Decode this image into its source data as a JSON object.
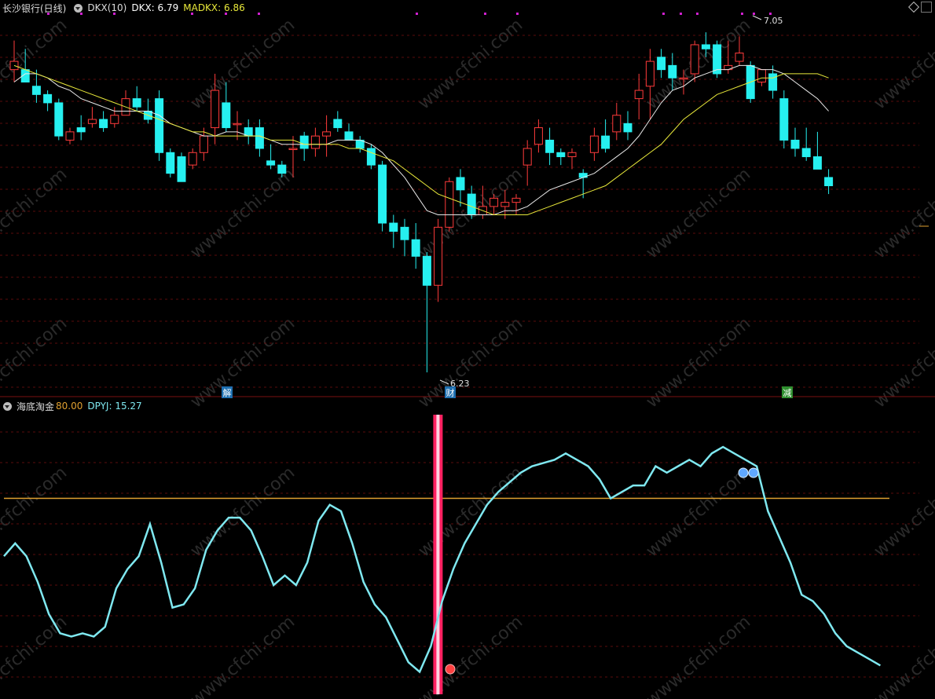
{
  "top_panel": {
    "stock_name": "长沙银行(日线)",
    "indicator_name": "DKX(10)",
    "dkx_label": "DKX: 6.79",
    "madkx_label": "MADKX: 6.86",
    "high_label": "7.05",
    "low_label": "6.23",
    "markers": [
      {
        "text": "解",
        "color": "#1e6fb0"
      },
      {
        "text": "财",
        "color": "#1e6fb0"
      },
      {
        "text": "减",
        "color": "#2f8f2f"
      }
    ]
  },
  "bottom_panel": {
    "indicator_name": "海底淘金",
    "level_label": "80.00",
    "dpyj_label": "DPYJ: 15.27"
  },
  "colors": {
    "up": "#ff3b3b",
    "down": "#26f0f0",
    "dkx_line": "#e8e8e8",
    "madkx_line": "#e8e83a",
    "osc_line": "#7fe8f0",
    "level_line": "#e0a030",
    "signal_bar": "#ff2060",
    "grid": "#5a0c0c"
  },
  "chart_data": {
    "type": "candlestick",
    "candles": [
      {
        "o": 6.96,
        "h": 7.03,
        "l": 6.93,
        "c": 6.98
      },
      {
        "o": 6.96,
        "h": 7.01,
        "l": 6.94,
        "c": 6.93
      },
      {
        "o": 6.92,
        "h": 6.96,
        "l": 6.88,
        "c": 6.9
      },
      {
        "o": 6.9,
        "h": 6.91,
        "l": 6.86,
        "c": 6.88
      },
      {
        "o": 6.88,
        "h": 6.89,
        "l": 6.79,
        "c": 6.8
      },
      {
        "o": 6.79,
        "h": 6.82,
        "l": 6.78,
        "c": 6.81
      },
      {
        "o": 6.82,
        "h": 6.85,
        "l": 6.79,
        "c": 6.81
      },
      {
        "o": 6.83,
        "h": 6.87,
        "l": 6.82,
        "c": 6.84
      },
      {
        "o": 6.84,
        "h": 6.86,
        "l": 6.81,
        "c": 6.82
      },
      {
        "o": 6.83,
        "h": 6.87,
        "l": 6.82,
        "c": 6.85
      },
      {
        "o": 6.85,
        "h": 6.91,
        "l": 6.86,
        "c": 6.89
      },
      {
        "o": 6.89,
        "h": 6.92,
        "l": 6.86,
        "c": 6.87
      },
      {
        "o": 6.86,
        "h": 6.89,
        "l": 6.83,
        "c": 6.84
      },
      {
        "o": 6.89,
        "h": 6.91,
        "l": 6.74,
        "c": 6.76
      },
      {
        "o": 6.76,
        "h": 6.77,
        "l": 6.7,
        "c": 6.71
      },
      {
        "o": 6.75,
        "h": 6.76,
        "l": 6.69,
        "c": 6.69
      },
      {
        "o": 6.73,
        "h": 6.77,
        "l": 6.72,
        "c": 6.76
      },
      {
        "o": 6.76,
        "h": 6.82,
        "l": 6.74,
        "c": 6.8
      },
      {
        "o": 6.82,
        "h": 6.95,
        "l": 6.78,
        "c": 6.91
      },
      {
        "o": 6.88,
        "h": 6.93,
        "l": 6.81,
        "c": 6.82
      },
      {
        "o": 6.83,
        "h": 6.86,
        "l": 6.79,
        "c": 6.83
      },
      {
        "o": 6.82,
        "h": 6.84,
        "l": 6.78,
        "c": 6.8
      },
      {
        "o": 6.82,
        "h": 6.84,
        "l": 6.75,
        "c": 6.77
      },
      {
        "o": 6.74,
        "h": 6.78,
        "l": 6.72,
        "c": 6.73
      },
      {
        "o": 6.73,
        "h": 6.74,
        "l": 6.7,
        "c": 6.71
      },
      {
        "o": 6.77,
        "h": 6.8,
        "l": 6.7,
        "c": 6.77
      },
      {
        "o": 6.8,
        "h": 6.81,
        "l": 6.74,
        "c": 6.77
      },
      {
        "o": 6.77,
        "h": 6.82,
        "l": 6.75,
        "c": 6.8
      },
      {
        "o": 6.8,
        "h": 6.85,
        "l": 6.75,
        "c": 6.81
      },
      {
        "o": 6.84,
        "h": 6.86,
        "l": 6.81,
        "c": 6.82
      },
      {
        "o": 6.81,
        "h": 6.83,
        "l": 6.79,
        "c": 6.79
      },
      {
        "o": 6.79,
        "h": 6.8,
        "l": 6.76,
        "c": 6.77
      },
      {
        "o": 6.77,
        "h": 6.78,
        "l": 6.72,
        "c": 6.73
      },
      {
        "o": 6.73,
        "h": 6.74,
        "l": 6.57,
        "c": 6.59
      },
      {
        "o": 6.59,
        "h": 6.61,
        "l": 6.53,
        "c": 6.57
      },
      {
        "o": 6.58,
        "h": 6.6,
        "l": 6.51,
        "c": 6.55
      },
      {
        "o": 6.55,
        "h": 6.59,
        "l": 6.48,
        "c": 6.51
      },
      {
        "o": 6.51,
        "h": 6.52,
        "l": 6.23,
        "c": 6.44
      },
      {
        "o": 6.44,
        "h": 6.6,
        "l": 6.4,
        "c": 6.58
      },
      {
        "o": 6.58,
        "h": 6.7,
        "l": 6.57,
        "c": 6.69
      },
      {
        "o": 6.7,
        "h": 6.72,
        "l": 6.63,
        "c": 6.67
      },
      {
        "o": 6.66,
        "h": 6.68,
        "l": 6.6,
        "c": 6.61
      },
      {
        "o": 6.61,
        "h": 6.68,
        "l": 6.6,
        "c": 6.63
      },
      {
        "o": 6.63,
        "h": 6.66,
        "l": 6.61,
        "c": 6.65
      },
      {
        "o": 6.63,
        "h": 6.67,
        "l": 6.6,
        "c": 6.64
      },
      {
        "o": 6.64,
        "h": 6.66,
        "l": 6.61,
        "c": 6.65
      },
      {
        "o": 6.73,
        "h": 6.79,
        "l": 6.68,
        "c": 6.77
      },
      {
        "o": 6.78,
        "h": 6.84,
        "l": 6.76,
        "c": 6.82
      },
      {
        "o": 6.79,
        "h": 6.82,
        "l": 6.73,
        "c": 6.76
      },
      {
        "o": 6.76,
        "h": 6.77,
        "l": 6.73,
        "c": 6.75
      },
      {
        "o": 6.75,
        "h": 6.77,
        "l": 6.72,
        "c": 6.76
      },
      {
        "o": 6.71,
        "h": 6.72,
        "l": 6.65,
        "c": 6.7
      },
      {
        "o": 6.76,
        "h": 6.82,
        "l": 6.74,
        "c": 6.8
      },
      {
        "o": 6.8,
        "h": 6.84,
        "l": 6.76,
        "c": 6.77
      },
      {
        "o": 6.81,
        "h": 6.88,
        "l": 6.79,
        "c": 6.85
      },
      {
        "o": 6.83,
        "h": 6.86,
        "l": 6.79,
        "c": 6.81
      },
      {
        "o": 6.89,
        "h": 6.95,
        "l": 6.84,
        "c": 6.91
      },
      {
        "o": 6.92,
        "h": 7.01,
        "l": 6.84,
        "c": 6.98
      },
      {
        "o": 6.99,
        "h": 7.01,
        "l": 6.94,
        "c": 6.96
      },
      {
        "o": 6.97,
        "h": 7.0,
        "l": 6.91,
        "c": 6.94
      },
      {
        "o": 6.94,
        "h": 6.96,
        "l": 6.9,
        "c": 6.94
      },
      {
        "o": 6.95,
        "h": 7.03,
        "l": 6.93,
        "c": 7.02
      },
      {
        "o": 7.02,
        "h": 7.05,
        "l": 6.99,
        "c": 7.01
      },
      {
        "o": 7.02,
        "h": 7.03,
        "l": 6.94,
        "c": 6.95
      },
      {
        "o": 6.96,
        "h": 7.03,
        "l": 6.95,
        "c": 6.97
      },
      {
        "o": 6.98,
        "h": 7.04,
        "l": 6.97,
        "c": 7.0
      },
      {
        "o": 6.97,
        "h": 6.98,
        "l": 6.88,
        "c": 6.89
      },
      {
        "o": 6.93,
        "h": 6.96,
        "l": 6.92,
        "c": 6.96
      },
      {
        "o": 6.95,
        "h": 6.97,
        "l": 6.89,
        "c": 6.91
      },
      {
        "o": 6.89,
        "h": 6.91,
        "l": 6.77,
        "c": 6.79
      },
      {
        "o": 6.79,
        "h": 6.82,
        "l": 6.75,
        "c": 6.77
      },
      {
        "o": 6.77,
        "h": 6.82,
        "l": 6.74,
        "c": 6.75
      },
      {
        "o": 6.75,
        "h": 6.81,
        "l": 6.72,
        "c": 6.72
      },
      {
        "o": 6.7,
        "h": 6.72,
        "l": 6.66,
        "c": 6.68
      }
    ],
    "dkx": [
      6.93,
      6.95,
      6.95,
      6.94,
      6.92,
      6.91,
      6.89,
      6.88,
      6.87,
      6.86,
      6.86,
      6.86,
      6.86,
      6.85,
      6.83,
      6.82,
      6.81,
      6.8,
      6.8,
      6.81,
      6.81,
      6.8,
      6.8,
      6.79,
      6.78,
      6.78,
      6.78,
      6.78,
      6.78,
      6.79,
      6.79,
      6.79,
      6.78,
      6.76,
      6.73,
      6.7,
      6.66,
      6.62,
      6.61,
      6.61,
      6.61,
      6.61,
      6.61,
      6.61,
      6.62,
      6.62,
      6.63,
      6.65,
      6.67,
      6.68,
      6.69,
      6.7,
      6.71,
      6.73,
      6.75,
      6.77,
      6.8,
      6.84,
      6.88,
      6.91,
      6.92,
      6.94,
      6.95,
      6.96,
      6.96,
      6.97,
      6.97,
      6.96,
      6.96,
      6.95,
      6.93,
      6.91,
      6.89,
      6.86
    ],
    "madkx": [
      6.97,
      6.96,
      6.95,
      6.94,
      6.93,
      6.92,
      6.91,
      6.9,
      6.89,
      6.88,
      6.87,
      6.86,
      6.85,
      6.84,
      6.83,
      6.82,
      6.81,
      6.81,
      6.8,
      6.8,
      6.8,
      6.8,
      6.8,
      6.79,
      6.79,
      6.79,
      6.78,
      6.78,
      6.78,
      6.78,
      6.77,
      6.77,
      6.76,
      6.75,
      6.74,
      6.72,
      6.7,
      6.68,
      6.66,
      6.65,
      6.64,
      6.63,
      6.62,
      6.61,
      6.61,
      6.61,
      6.61,
      6.62,
      6.63,
      6.64,
      6.65,
      6.66,
      6.67,
      6.68,
      6.7,
      6.72,
      6.74,
      6.76,
      6.78,
      6.81,
      6.84,
      6.86,
      6.88,
      6.9,
      6.91,
      6.92,
      6.93,
      6.94,
      6.94,
      6.95,
      6.95,
      6.95,
      6.95,
      6.94
    ],
    "oscillator": [
      62,
      66,
      62,
      54,
      44,
      38,
      37,
      38,
      37,
      40,
      52,
      58,
      62,
      72,
      60,
      46,
      47,
      52,
      64,
      70,
      74,
      74,
      70,
      62,
      53,
      56,
      53,
      60,
      73,
      78,
      76,
      66,
      54,
      47,
      43,
      36,
      29,
      26,
      34,
      48,
      58,
      66,
      72,
      78,
      82,
      85,
      88,
      90,
      91,
      92,
      94,
      92,
      90,
      86,
      80,
      82,
      84,
      84,
      90,
      88,
      90,
      92,
      90,
      94,
      96,
      94,
      92,
      90,
      76,
      68,
      60,
      50,
      48,
      44,
      38,
      34,
      32,
      30,
      28
    ],
    "signal_bar_index": 37,
    "level": 80
  }
}
